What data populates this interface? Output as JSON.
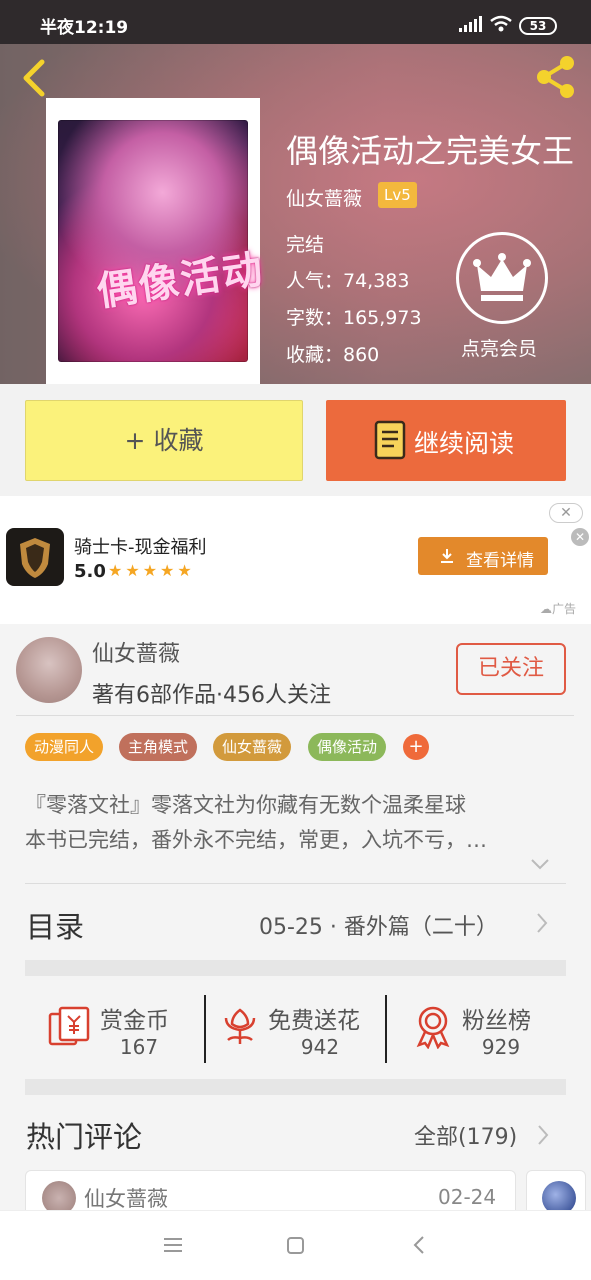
{
  "status_bar": {
    "time": "半夜12:19",
    "battery": "53"
  },
  "book": {
    "title": "偶像活动之完美女王",
    "author": "仙女蔷薇",
    "author_level": "Lv5",
    "status": "完结",
    "popularity": "人气：74,383",
    "word_count": "字数：165,973",
    "favorites": "收藏：860",
    "cover_title_art": "偶像活动",
    "vip_label": "点亮会员"
  },
  "actions": {
    "collect": "+ 收藏",
    "read": "继续阅读"
  },
  "ad": {
    "title": "骑士卡-现金福利",
    "score": "5.0",
    "stars": "★★★★★",
    "button": "查看详情",
    "tag": "广告"
  },
  "author_info": {
    "name": "仙女蔷薇",
    "meta": "著有6部作品·456人关注",
    "follow": "已关注"
  },
  "tags": [
    {
      "label": "动漫同人",
      "color": "#f2a22b"
    },
    {
      "label": "主角模式",
      "color": "#c0705c"
    },
    {
      "label": "仙女蔷薇",
      "color": "#d29a3c"
    },
    {
      "label": "偶像活动",
      "color": "#8cb85a"
    }
  ],
  "description": {
    "line1": "『零落文社』零落文社为你藏有无数个温柔星球",
    "line2": "本书已完结，番外永不完结，常更，入坑不亏，…"
  },
  "toc": {
    "label": "目录",
    "latest": "05-25 · 番外篇（二十）"
  },
  "rewards": [
    {
      "title": "赏金币",
      "value": "167",
      "icon": "red-envelope-icon"
    },
    {
      "title": "免费送花",
      "value": "942",
      "icon": "flower-icon"
    },
    {
      "title": "粉丝榜",
      "value": "929",
      "icon": "medal-icon"
    }
  ],
  "comments": {
    "title": "热门评论",
    "all": "全部(179)",
    "first": {
      "user": "仙女蔷薇",
      "date": "02-24"
    }
  },
  "colors": {
    "accent": "#ec6a3d",
    "collect_bg": "#fbf27b",
    "follow": "#e05a44"
  }
}
